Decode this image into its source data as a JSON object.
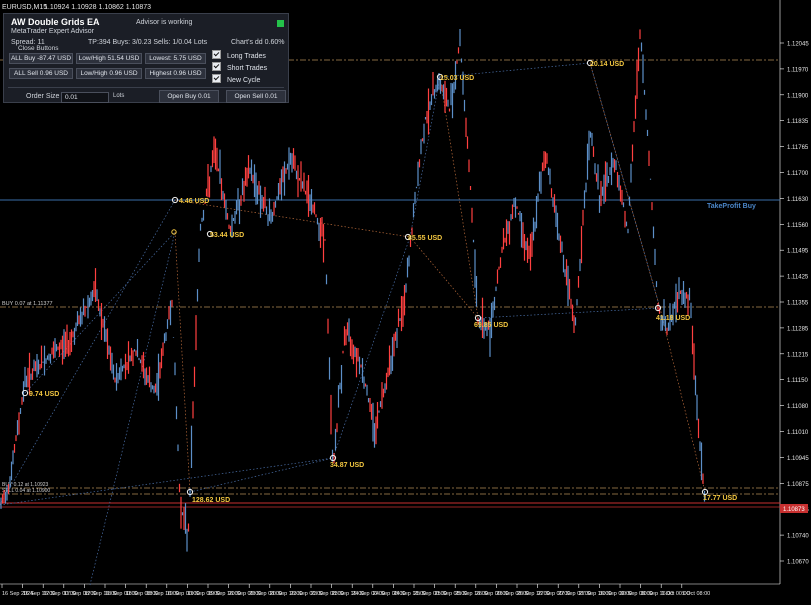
{
  "window": {
    "symbol_timeframe": "EURUSD,M15",
    "quote": "1.10924 1.10928 1.10862 1.10873"
  },
  "panel": {
    "title": "AW Double Grids EA",
    "subtitle": "MetaTrader Expert Advisor",
    "status": "Advisor is working",
    "spread": "Spread: 11",
    "trade_stats": "TP:394 Buys: 3/0.23 Sells: 1/0.04 Lots",
    "charts_dd": "Chart's dd 0.60%",
    "close_buttons_label": "Close Buttons",
    "buttons": {
      "all_buy": "ALL Buy -87.47 USD",
      "low_high_1": "Low/High 51.54 USD",
      "lowest": "Lowest: 5.75 USD",
      "all_sell": "ALL Sell 0.96 USD",
      "low_high_2": "Low/High 0.96 USD",
      "highest": "Highest 0.96 USD",
      "open_buy": "Open Buy 0.01",
      "open_sell": "Open Sell 0.01"
    },
    "checkboxes": [
      {
        "label": "Long Trades",
        "checked": true
      },
      {
        "label": "Short Trades",
        "checked": true
      },
      {
        "label": "New Cycle",
        "checked": true
      }
    ],
    "order_size_label": "Order Size",
    "order_size_value": "0.01",
    "lots_label": "Lots"
  },
  "price_axis": {
    "labels": [
      "1.12045",
      "1.11970",
      "1.11900",
      "1.11835",
      "1.11765",
      "1.11700",
      "1.11630",
      "1.11560",
      "1.11495",
      "1.11425",
      "1.11355",
      "1.11285",
      "1.11215",
      "1.11150",
      "1.11080",
      "1.11010",
      "1.10945",
      "1.10875",
      "1.10805",
      "1.10740",
      "1.10670"
    ],
    "current_price": "1.10873"
  },
  "time_axis": {
    "labels": [
      "16 Sep 2024",
      "16 Sep 16:00",
      "17 Sep 00:00",
      "17 Sep 08:00",
      "17 Sep 16:00",
      "18 Sep 00:00",
      "18 Sep 08:00",
      "18 Sep 16:00",
      "19 Sep 00:00",
      "19 Sep 08:00",
      "19 Sep 16:00",
      "20 Sep 00:00",
      "20 Sep 08:00",
      "20 Sep 16:00",
      "23 Sep 00:00",
      "23 Sep 08:00",
      "23 Sep 16:00",
      "24 Sep 00:00",
      "24 Sep 08:00",
      "24 Sep 16:00",
      "25 Sep 00:00",
      "25 Sep 08:00",
      "25 Sep 16:00",
      "26 Sep 00:00",
      "26 Sep 08:00",
      "26 Sep 16:00",
      "27 Sep 00:00",
      "27 Sep 08:00",
      "27 Sep 16:00",
      "30 Sep 00:00",
      "30 Sep 08:00",
      "30 Sep 16:00",
      "1 Oct 00:00",
      "1 Oct 08:00"
    ]
  },
  "lines": {
    "take_profit_label": "TakeProfit Buy",
    "buy_line_label": "BUY 0.07 at 1.11377",
    "buy_line_2_label": "BUY 0.12 at 1.10923",
    "sell_line_label": "SELL 0.04 at 1.10900"
  },
  "profit_labels": [
    "4.46 USD",
    "53.44 USD",
    "85.55 USD",
    "15.03 USD",
    "20.14 USD",
    "69.85 USD",
    "41.18 USD",
    "9.74 USD",
    "34.87 USD",
    "128.62 USD",
    "17.77 USD"
  ],
  "colors": {
    "background": "#000000",
    "bull_candle": "#ff4040",
    "bear_candle": "#5c8fc8",
    "profit_label": "#f2c640",
    "take_profit_line": "#3a6ea8",
    "dashed_line": "#b08a55",
    "sell_line": "#c83030"
  }
}
